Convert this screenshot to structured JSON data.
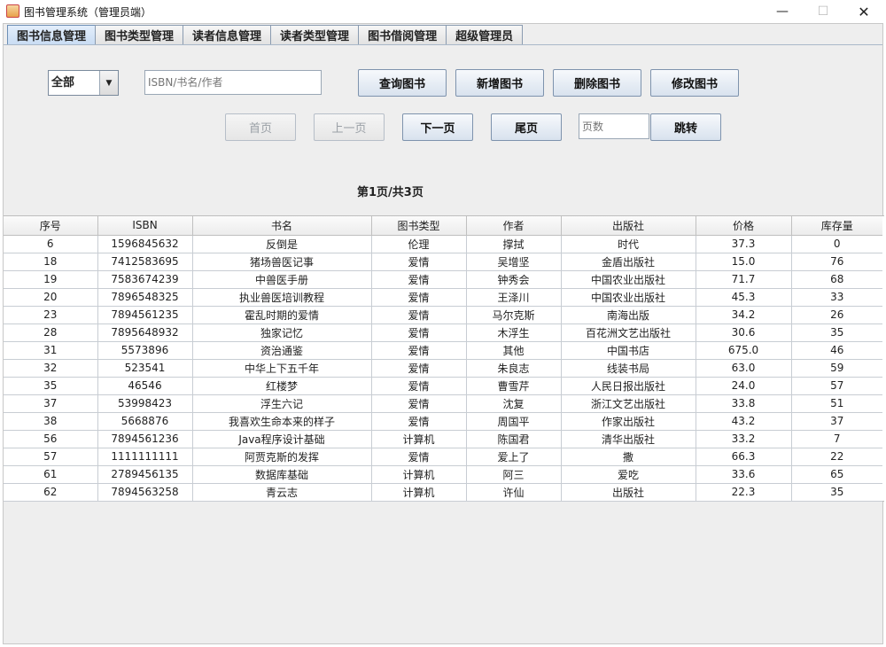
{
  "window": {
    "title": "图书管理系统（管理员端）",
    "minimize": "—",
    "maximize": "☐",
    "close": "✕"
  },
  "tabs": [
    {
      "label": "图书信息管理",
      "active": true
    },
    {
      "label": "图书类型管理"
    },
    {
      "label": "读者信息管理"
    },
    {
      "label": "读者类型管理"
    },
    {
      "label": "图书借阅管理"
    },
    {
      "label": "超级管理员"
    }
  ],
  "filter": {
    "combo_value": "全部",
    "search_placeholder": "ISBN/书名/作者"
  },
  "actions": {
    "query": "查询图书",
    "add": "新增图书",
    "delete": "删除图书",
    "edit": "修改图书"
  },
  "pager": {
    "first": "首页",
    "prev": "上一页",
    "next": "下一页",
    "last": "尾页",
    "page_placeholder": "页数",
    "jump": "跳转",
    "info": "第1页/共3页"
  },
  "table": {
    "columns": [
      "序号",
      "ISBN",
      "书名",
      "图书类型",
      "作者",
      "出版社",
      "价格",
      "库存量"
    ],
    "rows": [
      [
        "6",
        "1596845632",
        "反倒是",
        "伦理",
        "撑拭",
        "时代",
        "37.3",
        "0"
      ],
      [
        "18",
        "7412583695",
        "猪场兽医记事",
        "爱情",
        "吴增坚",
        "金盾出版社",
        "15.0",
        "76"
      ],
      [
        "19",
        "7583674239",
        "中兽医手册",
        "爱情",
        "钟秀会",
        "中国农业出版社",
        "71.7",
        "68"
      ],
      [
        "20",
        "7896548325",
        "执业兽医培训教程",
        "爱情",
        "王泽川",
        "中国农业出版社",
        "45.3",
        "33"
      ],
      [
        "23",
        "7894561235",
        "霍乱时期的爱情",
        "爱情",
        "马尔克斯",
        "南海出版",
        "34.2",
        "26"
      ],
      [
        "28",
        "7895648932",
        "独家记忆",
        "爱情",
        "木浮生",
        "百花洲文艺出版社",
        "30.6",
        "35"
      ],
      [
        "31",
        "5573896",
        "资治通鉴",
        "爱情",
        "其他",
        "中国书店",
        "675.0",
        "46"
      ],
      [
        "32",
        "523541",
        "中华上下五千年",
        "爱情",
        "朱良志",
        "线装书局",
        "63.0",
        "59"
      ],
      [
        "35",
        "46546",
        "红楼梦",
        "爱情",
        "曹雪芹",
        "人民日报出版社",
        "24.0",
        "57"
      ],
      [
        "37",
        "53998423",
        "浮生六记",
        "爱情",
        "沈复",
        "浙江文艺出版社",
        "33.8",
        "51"
      ],
      [
        "38",
        "5668876",
        "我喜欢生命本来的样子",
        "爱情",
        "周国平",
        "作家出版社",
        "43.2",
        "37"
      ],
      [
        "56",
        "7894561236",
        "Java程序设计基础",
        "计算机",
        "陈国君",
        "清华出版社",
        "33.2",
        "7"
      ],
      [
        "57",
        "1111111111",
        "阿贾克斯的发挥",
        "爱情",
        "爱上了",
        "撒",
        "66.3",
        "22"
      ],
      [
        "61",
        "2789456135",
        "数据库基础",
        "计算机",
        "阿三",
        "爱吃",
        "33.6",
        "65"
      ],
      [
        "62",
        "7894563258",
        "青云志",
        "计算机",
        "许仙",
        "出版社",
        "22.3",
        "35"
      ]
    ]
  }
}
